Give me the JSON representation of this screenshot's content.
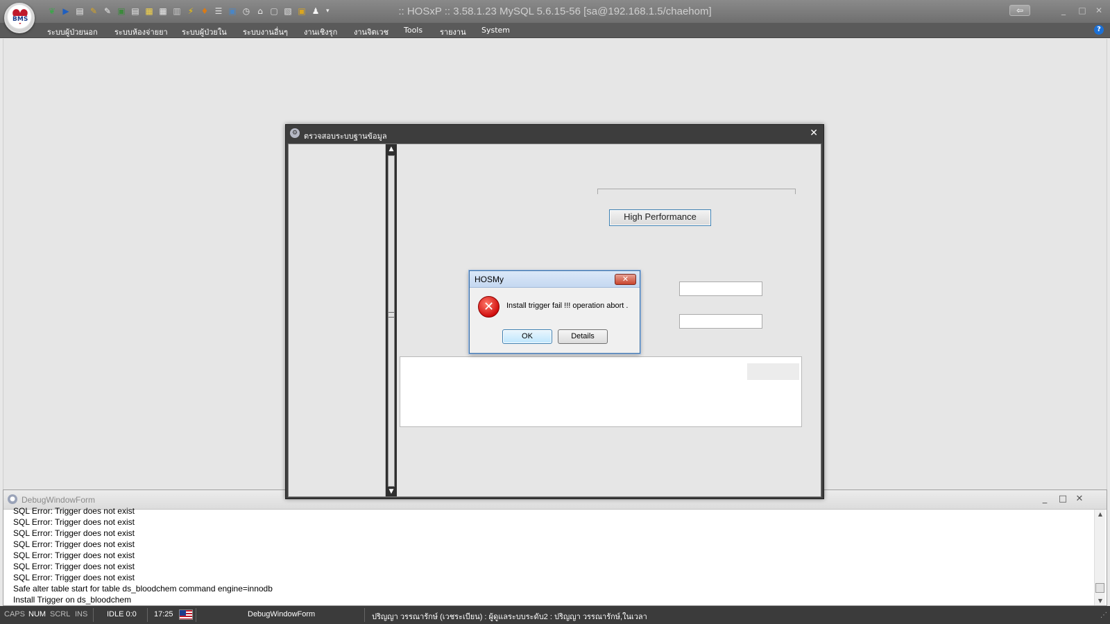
{
  "app": {
    "title": ":: HOSxP :: 3.58.1.23 MySQL 5.6.15-56 [sa@192.168.1.5/chaehom]",
    "logo_text": "BMS",
    "restore_glyph": "⇦",
    "min_glyph": "_",
    "max_glyph": "□",
    "close_glyph": "✕"
  },
  "toolbar": {
    "icons": [
      "leaf-icon",
      "play-icon",
      "page-icon",
      "pen-icon",
      "edit-icon",
      "note-icon",
      "doc-icon",
      "list-icon",
      "table-icon",
      "grid-icon",
      "bolt-icon",
      "person-icon",
      "menu-icon",
      "monitor-icon",
      "clock-icon",
      "home-icon",
      "window-icon",
      "gallery-icon",
      "photo-icon",
      "user-icon"
    ],
    "colors": [
      "#3fa34d",
      "#1f5fbf",
      "#e7e7e7",
      "#d9a520",
      "#f0f0f0",
      "#3c8a3c",
      "#e8e8e8",
      "#f2d24a",
      "#e8e8e8",
      "#c9c9c9",
      "#f5c400",
      "#d97a16",
      "#e0e0e0",
      "#4a86c5",
      "#e6e6e6",
      "#e9e9e9",
      "#d9d9d9",
      "#e4e4e4",
      "#d9a520",
      "#f5f5f5"
    ],
    "glyphs": [
      "❦",
      "▶",
      "▤",
      "✎",
      "✎",
      "▣",
      "▤",
      "▦",
      "▦",
      "▥",
      "⚡",
      "♦",
      "☰",
      "▣",
      "◷",
      "⌂",
      "▢",
      "▧",
      "▣",
      "♟"
    ],
    "dropdown_glyph": "▾"
  },
  "menu": {
    "items": [
      "ระบบผู้ป่วยนอก",
      "ระบบห้องจ่ายยา",
      "ระบบผู้ป่วยใน",
      "ระบบงานอื่นๆ",
      "งานเชิงรุก",
      "งานจิตเวช",
      "Tools",
      "รายงาน",
      "System"
    ],
    "help_glyph": "?"
  },
  "db_window": {
    "title": "ตรวจสอบระบบฐานข้อมูล",
    "close_glyph": "✕",
    "button_high_performance": "High Performance",
    "scroll_up": "▲",
    "scroll_down": "▼"
  },
  "message_box": {
    "title": "HOSMy",
    "close_glyph": "✕",
    "error_glyph": "✕",
    "message": "Install trigger fail !!! operation abort .",
    "ok_label": "OK",
    "details_label": "Details"
  },
  "debug_window": {
    "title": "DebugWindowForm",
    "lines": [
      "SQL Error: Trigger does not exist",
      "SQL Error: Trigger does not exist",
      "SQL Error: Trigger does not exist",
      "SQL Error: Trigger does not exist",
      "SQL Error: Trigger does not exist",
      "SQL Error: Trigger does not exist",
      "SQL Error: Trigger does not exist",
      "Safe alter table start for table ds_bloodchem command engine=innodb",
      "Install Trigger on ds_bloodchem"
    ],
    "min_glyph": "_",
    "max_glyph": "□",
    "close_glyph": "✕",
    "scroll_up": "▲",
    "scroll_down": "▼"
  },
  "status": {
    "caps": "CAPS",
    "num": "NUM",
    "scrl": "SCRL",
    "ins": "INS",
    "idle": "IDLE 0:0",
    "time": "17:25",
    "form": "DebugWindowForm",
    "user": "ปริญญา  วรรณารักษ์ (เวชระเบียน) : ผู้ดูแลระบบระดับ2 : ปริญญา  วรรณารักษ์,ในเวลา",
    "grip_glyph": "⋰"
  }
}
